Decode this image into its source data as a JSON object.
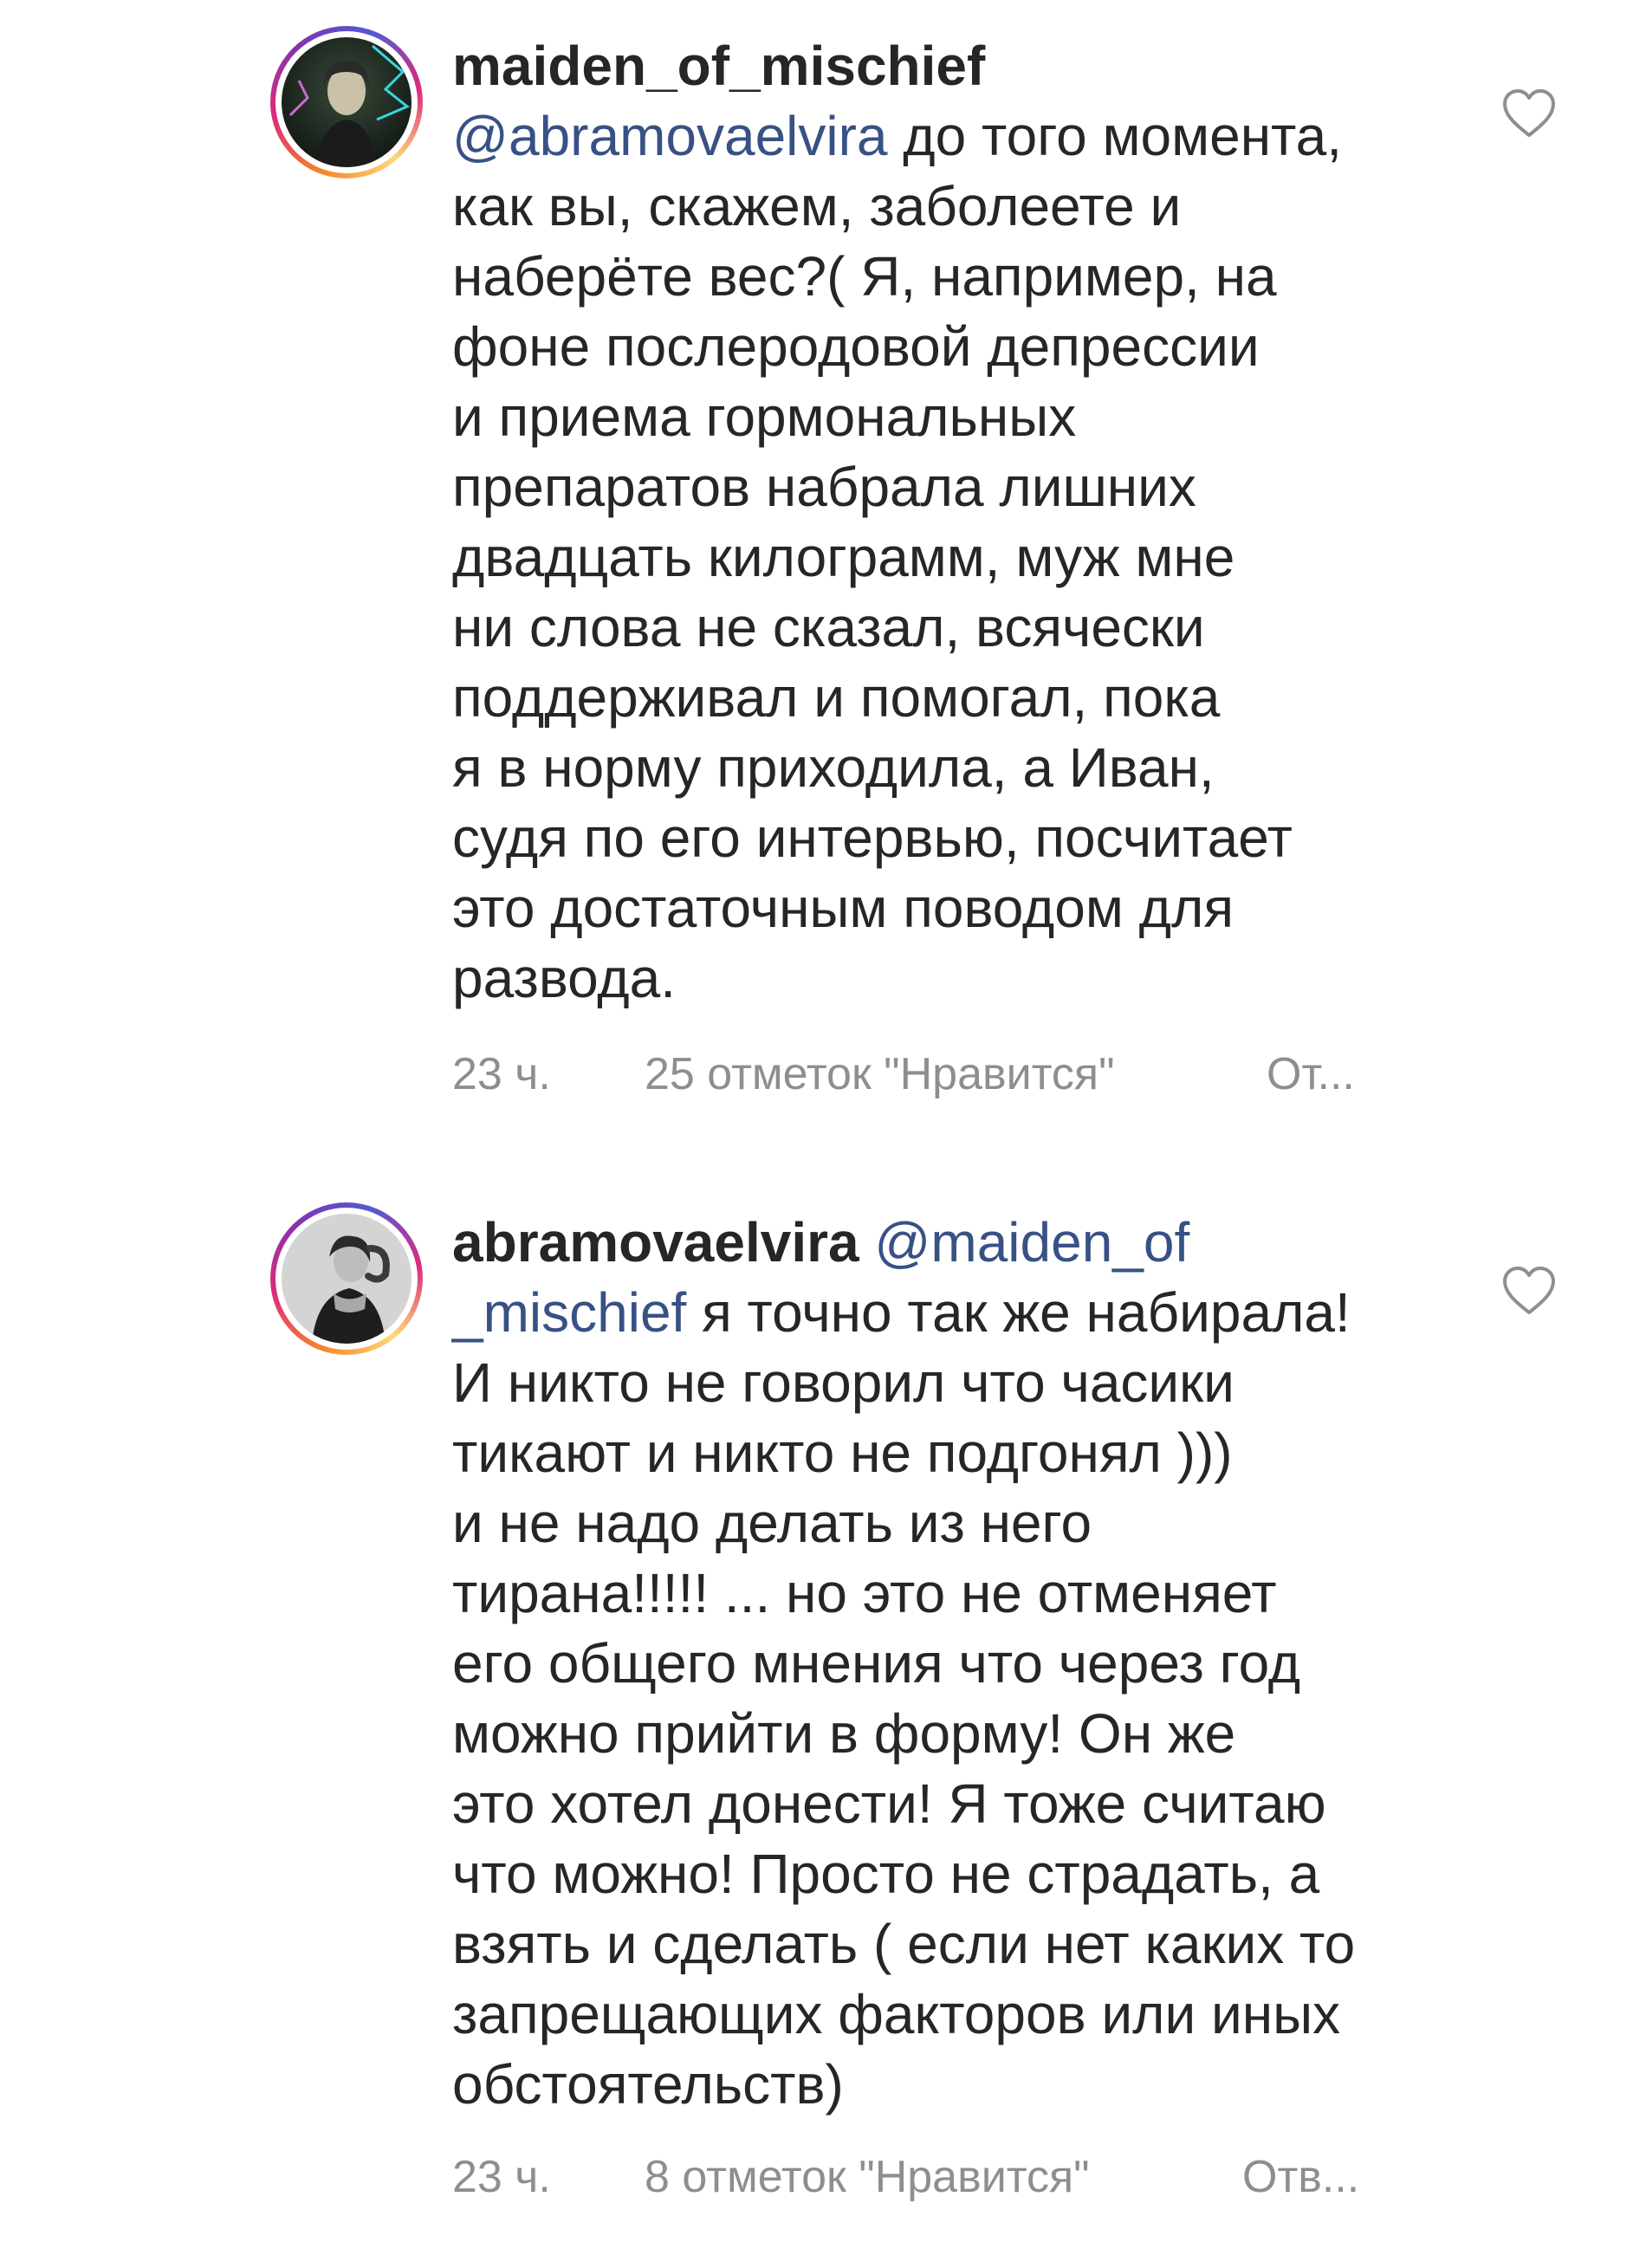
{
  "comments": [
    {
      "username": "maiden_of_mischief",
      "lines": [
        {
          "mention": "@abramovaelvira",
          "text": " до того момента,"
        },
        {
          "text": "как вы, скажем, заболеете и"
        },
        {
          "text": "наберёте вес?( Я, например, на"
        },
        {
          "text": "фоне послеродовой депрессии"
        },
        {
          "text": "и приема гормональных"
        },
        {
          "text": "препаратов набрала лишних"
        },
        {
          "text": "двадцать килограмм, муж мне"
        },
        {
          "text": "ни слова не сказал, всячески"
        },
        {
          "text": "поддерживал и помогал, пока"
        },
        {
          "text": "я в норму приходила, а Иван,"
        },
        {
          "text": "судя по его интервью, посчитает"
        },
        {
          "text": "это достаточным поводом для"
        },
        {
          "text": "развода."
        }
      ],
      "time": "23 ч.",
      "likes": "25 отметок \"Нравится\"",
      "reply": "От..."
    },
    {
      "username": "abramovaelvira",
      "first_line_mention": "@maiden_of",
      "lines": [
        {
          "mention": "_mischief",
          "text": " я точно так же набирала!"
        },
        {
          "text": "И никто не говорил что часики"
        },
        {
          "text": "тикают и никто не подгонял )))"
        },
        {
          "text": "и не надо делать из него"
        },
        {
          "text": "тирана!!!!! ... но это не отменяет"
        },
        {
          "text": "его общего мнения что через год"
        },
        {
          "text": "можно прийти в форму! Он же"
        },
        {
          "text": "это хотел донести! Я тоже считаю"
        },
        {
          "text": "что можно! Просто не страдать, а"
        },
        {
          "text": "взять и сделать ( если нет каких то"
        },
        {
          "text": "запрещающих факторов или иных"
        },
        {
          "text": "обстоятельств)"
        }
      ],
      "time": "23 ч.",
      "likes": "8 отметок \"Нравится\"",
      "reply": "Отв..."
    }
  ],
  "icons": {
    "like": "heart-outline-icon",
    "avatar_ring": "story-ring"
  },
  "colors": {
    "text": "#262626",
    "mention": "#385185",
    "meta": "#8e8e8e",
    "heart_stroke": "#8e8e8e"
  }
}
